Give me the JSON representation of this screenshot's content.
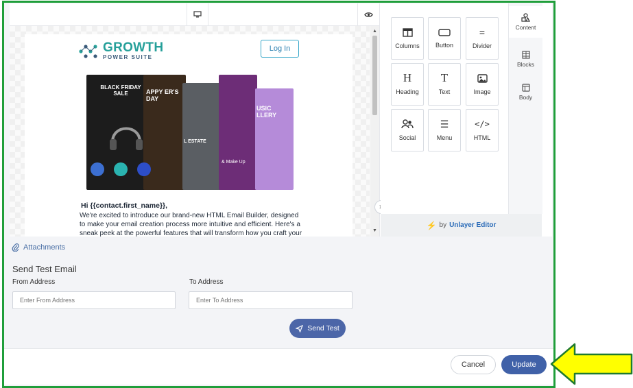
{
  "preview": {
    "logo": {
      "name": "GROWTH",
      "sub": "POWER SUITE"
    },
    "login_label": "Log In",
    "greeting": "Hi {{contact.first_name}},",
    "body": "We're excited to introduce our brand-new HTML Email Builder, designed to make your email creation process more intuitive and efficient. Here's a sneak peek at the powerful features that will transform how you craft your email"
  },
  "hero_cards": [
    {
      "text": "BLACK FRIDAY SALE",
      "color": "#1c1c1c"
    },
    {
      "text": "APPY ER'S DAY",
      "color": "#3a2a1c"
    },
    {
      "text": "L ESTATE",
      "color": "#5a5e63"
    },
    {
      "text": "& Make Up",
      "color": "#6d2d77"
    },
    {
      "text": "USIC LLERY",
      "color": "#b58bd9"
    }
  ],
  "tools": {
    "items": [
      {
        "label": "Columns",
        "icon": "columns-icon"
      },
      {
        "label": "Button",
        "icon": "button-icon"
      },
      {
        "label": "Divider",
        "icon": "divider-icon"
      },
      {
        "label": "Heading",
        "icon": "heading-icon"
      },
      {
        "label": "Text",
        "icon": "text-icon"
      },
      {
        "label": "Image",
        "icon": "image-icon"
      },
      {
        "label": "Social",
        "icon": "social-icon"
      },
      {
        "label": "Menu",
        "icon": "menu-icon"
      },
      {
        "label": "HTML",
        "icon": "html-icon"
      }
    ],
    "glyphs": {
      "heading": "H",
      "text": "T",
      "divider": "=",
      "menu": "☰",
      "html": "</>"
    }
  },
  "tabs": [
    {
      "label": "Content",
      "icon": "shapes-icon"
    },
    {
      "label": "Blocks",
      "icon": "blocks-icon"
    },
    {
      "label": "Body",
      "icon": "body-layout-icon"
    }
  ],
  "unlayer": {
    "by": "by",
    "name": "Unlayer Editor"
  },
  "attachments_label": "Attachments",
  "send_test": {
    "title": "Send Test Email",
    "from_label": "From Address",
    "from_placeholder": "Enter From Address",
    "to_label": "To Address",
    "to_placeholder": "Enter To Address",
    "button_label": "Send Test"
  },
  "footer": {
    "cancel_label": "Cancel",
    "update_label": "Update"
  },
  "colors": {
    "frame": "#1f9e3a",
    "primary": "#4061a8",
    "arrow": "#ffff00"
  }
}
